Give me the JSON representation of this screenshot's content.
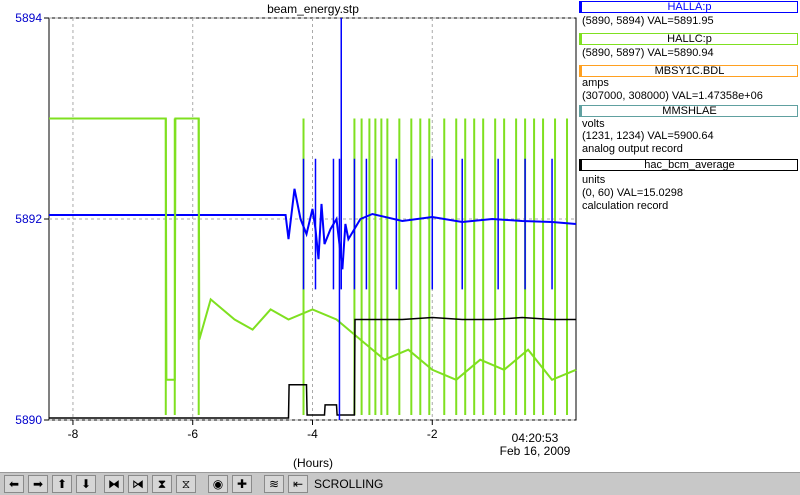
{
  "chart_data": {
    "type": "line",
    "title": "beam_energy.stp",
    "xlabel": "(Hours)",
    "x_range": [
      -8.4,
      0.4
    ],
    "x_ticks": [
      -8,
      -6,
      -4,
      -2
    ],
    "y_ticks": [
      5890,
      5892,
      5894
    ],
    "y_range": [
      5890,
      5894
    ],
    "time_label": "04:20:53",
    "date_label": "Feb 16, 2009",
    "grid": true,
    "series": [
      {
        "name": "HALLA:p",
        "color": "#0000ff",
        "label_color": "#0000ff",
        "x": [
          -8.4,
          -4.45,
          -4.4,
          -4.3,
          -4.2,
          -4.1,
          -4.0,
          -3.95,
          -3.9,
          -3.85,
          -3.8,
          -3.7,
          -3.6,
          -3.5,
          -3.45,
          -3.4,
          -3.3,
          -3.2,
          -3.0,
          -2.5,
          -2.0,
          -1.5,
          -1.0,
          -0.5,
          0.0,
          0.4
        ],
        "y": [
          5892.04,
          5892.04,
          5891.8,
          5892.3,
          5892.0,
          5891.85,
          5892.1,
          5891.9,
          5891.6,
          5892.15,
          5891.75,
          5891.9,
          5892.0,
          5891.5,
          5891.95,
          5891.8,
          5891.9,
          5892.0,
          5892.05,
          5891.98,
          5892.02,
          5891.97,
          5892.0,
          5891.98,
          5891.97,
          5891.95
        ]
      },
      {
        "name": "HALLC:p",
        "color": "#7fe020",
        "x": [
          -8.4,
          -6.45,
          -6.44,
          -6.3,
          -6.29,
          -5.9,
          -5.89,
          -5.7,
          -5.3,
          -5.0,
          -4.7,
          -4.4,
          -4.0,
          -3.6,
          -3.2,
          -2.8,
          -2.4,
          -2.0,
          -1.6,
          -1.2,
          -0.8,
          -0.4,
          0.0,
          0.4
        ],
        "y": [
          5893.0,
          5893.0,
          5890.4,
          5890.4,
          5893.0,
          5893.0,
          5890.8,
          5891.2,
          5891.0,
          5890.9,
          5891.1,
          5891.0,
          5891.1,
          5891.0,
          5890.8,
          5890.6,
          5890.7,
          5890.5,
          5890.4,
          5890.6,
          5890.5,
          5890.7,
          5890.4,
          5890.5
        ]
      },
      {
        "name": "hac_bcm_average",
        "color": "#000000",
        "x": [
          -8.4,
          -4.4,
          -4.39,
          -4.1,
          -4.09,
          -3.8,
          -3.79,
          -3.6,
          -3.59,
          -3.3,
          -3.29,
          -2.5,
          -2.0,
          -1.5,
          -1.0,
          -0.5,
          0.0,
          0.4
        ],
        "y": [
          5890.02,
          5890.02,
          5890.35,
          5890.35,
          5890.05,
          5890.05,
          5890.15,
          5890.15,
          5890.05,
          5890.05,
          5891.0,
          5891.0,
          5891.02,
          5891.0,
          5891.0,
          5891.02,
          5891.0,
          5891.0
        ]
      }
    ],
    "green_spikes_x": [
      -6.45,
      -6.3,
      -5.9,
      -4.15,
      -3.3,
      -3.18,
      -3.05,
      -2.95,
      -2.85,
      -2.75,
      -2.55,
      -2.35,
      -2.2,
      -2.05,
      -1.8,
      -1.6,
      -1.45,
      -1.3,
      -1.15,
      -0.95,
      -0.8,
      -0.6,
      -0.45,
      -0.3,
      -0.15,
      0.05,
      0.25
    ],
    "blue_spikes_x": [
      -4.15,
      -3.95,
      -3.65,
      -3.55,
      -3.52,
      -3.3,
      -3.1,
      -2.6,
      -2.0,
      -1.5,
      -0.9,
      -0.45,
      0.0
    ]
  },
  "legend": {
    "halla": {
      "title": "HALLA:p",
      "line1": "(5890, 5894) VAL=5891.95",
      "color": "#0000ff"
    },
    "hallc": {
      "title": "HALLC:p",
      "line1": "(5890, 5897) VAL=5890.94",
      "color": "#7fe020"
    },
    "mbsy": {
      "title": "MBSY1C.BDL",
      "line1": "amps",
      "line2": "(307000, 308000) VAL=1.47358e+06",
      "color": "#ffa020"
    },
    "mmshlae": {
      "title": "MMSHLAE",
      "line1": "volts",
      "line2": "(1231, 1234) VAL=5900.64",
      "line3": "analog output record",
      "color": "#60a0a0"
    },
    "bcm": {
      "title": "hac_bcm_average",
      "line1": "units",
      "line2": "(0, 60) VAL=15.0298",
      "line3": "calculation record",
      "color": "#000000"
    }
  },
  "toolbar": {
    "mode_label": "SCROLLING",
    "buttons": [
      "arrow-left-icon",
      "arrow-right-icon",
      "arrow-up-icon",
      "arrow-down-icon",
      "zoom-in-x-icon",
      "zoom-out-x-icon",
      "zoom-in-y-icon",
      "zoom-out-y-icon",
      "record-icon",
      "add-icon",
      "auto-scale-icon",
      "scroll-mode-icon"
    ],
    "glyphs": [
      "⬅",
      "➡",
      "⬆",
      "⬇",
      "⧓",
      "⧒",
      "⧗",
      "⧖",
      "◉",
      "✚",
      "≋",
      "⇤"
    ]
  }
}
